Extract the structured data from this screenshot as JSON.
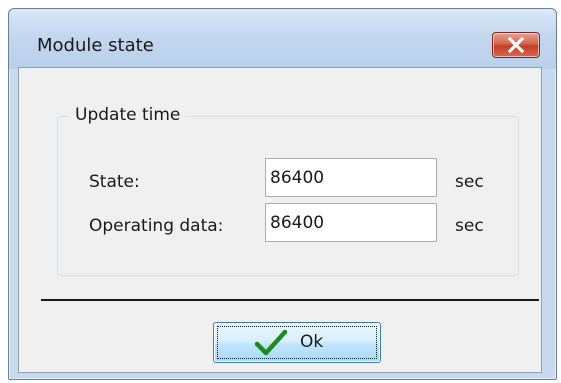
{
  "window": {
    "title": "Module state"
  },
  "group": {
    "title": "Update time"
  },
  "fields": [
    {
      "label": "State:",
      "value": "86400",
      "unit": "sec"
    },
    {
      "label": "Operating data:",
      "value": "86400",
      "unit": "sec"
    }
  ],
  "buttons": {
    "ok_label": "Ok",
    "close_icon": "close-icon",
    "ok_icon": "checkmark-icon"
  },
  "colors": {
    "checkmark": "#1e8a1e",
    "close_button": "#c84a33"
  }
}
